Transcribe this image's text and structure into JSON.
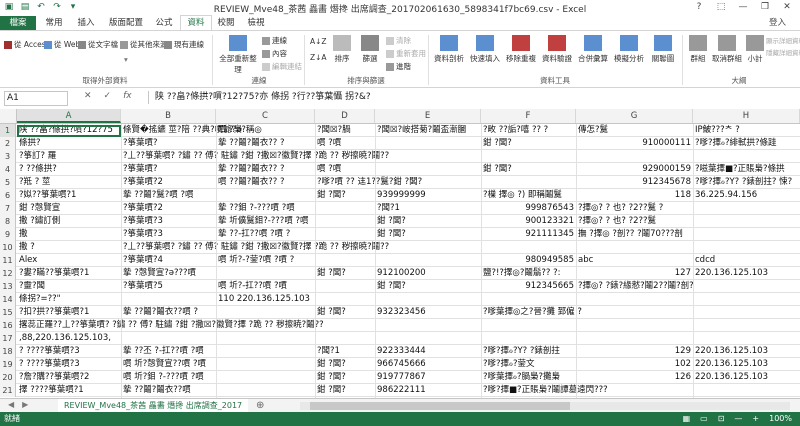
{
  "title": "REVIEW_Mve48_茶茜 畾畵 熸搀 出席調查_201702061630_5898341f7bc69.csv - Excel",
  "window_controls": [
    "?",
    "⬚",
    "—",
    "❐",
    "✕"
  ],
  "user": "登入",
  "tabs": [
    "檔案",
    "常用",
    "插入",
    "版面配置",
    "公式",
    "資料",
    "校閱",
    "檢視"
  ],
  "active_tab": "資料",
  "ribbon": {
    "groups": [
      {
        "label": "取得外部資料",
        "buttons": [
          "從 Access",
          "從 Web",
          "從文字檔",
          "從其他來源",
          "現有連線"
        ]
      },
      {
        "label": "連線",
        "buttons": [
          "全部重新整理",
          "連線",
          "內容",
          "編輯連結"
        ]
      },
      {
        "label": "排序與篩選",
        "buttons": [
          "排序",
          "篩選",
          "清除",
          "重新套用",
          "進階"
        ]
      },
      {
        "label": "資料工具",
        "buttons": [
          "資料剖析",
          "快速填入",
          "移除重複",
          "資料驗證",
          "合併彙算",
          "模擬分析",
          "關聯圖"
        ]
      },
      {
        "label": "大綱",
        "buttons": [
          "群組",
          "取消群組",
          "小計",
          "顯示詳細資料",
          "隱藏詳細資料"
        ]
      }
    ]
  },
  "name_box": "A1",
  "formula_icons": [
    "✕",
    "✓",
    "fx"
  ],
  "formula": "陕 ??畠?條拱?嘪?12?75?亦 條拐 ?行??箏葉懾 拐?&?",
  "columns": [
    "A",
    "B",
    "C",
    "D",
    "E",
    "F",
    "G",
    "H"
  ],
  "rows": [
    {
      "n": "1",
      "cells": [
        "陕 ??畠?條拱?嘪?12?75",
        "條賢�搖鑣 莖?陪 ??典?嘪爺?ǝ?稱◎",
        "嘪 ?梟",
        "?闆☒?腡",
        "?闆☒?峖搭菊?鬮盃漸膕",
        "?畋 ??詬?嘻 ?? ?",
        "傳怎?鬕",
        "IP鮍???ᄎ ?"
      ]
    },
    {
      "n": "2",
      "cells": [
        "條拱?",
        "?箏葉嘪?",
        "摯 ??鬮?鬮衣?? ?",
        "嘪 ?嘪",
        "",
        "鉗 ?闆?",
        "910000111",
        "?嗲?擇ℴ?緋軾拱?條跬"
      ]
    },
    {
      "n": "3",
      "cells": [
        "?箏訂? 羅",
        "?丄??箏葉嘪? ?鏽 ?? 傅? 駐鏽 ?鉗 ?撒☒?徽賢?擇 ?跪 ?? 秽擦暁?鬮??",
        "",
        "",
        "",
        "",
        "",
        ""
      ]
    },
    {
      "n": "4",
      "cells": [
        "? ??條拱?",
        "?箏葉嘪?",
        "摯 ??鬮?鬮衣?? ?",
        "嘪 ?嘪",
        "",
        "鉗 ?闆?",
        "929000159",
        "?嗞葉擇■?正賬梟?條拱"
      ]
    },
    {
      "n": "5",
      "cells": [
        "?羝 ? 莖",
        "?箏葉嘪?2",
        "嘪 ??鬮?鬮衣?? ?",
        "?嗲?嘪 ?? 迬1??鬕?鉗 ?闆?",
        "",
        "",
        "912345678",
        "?嗲?擇ℴ?Y? ?錶剖拄? 悚?"
      ]
    },
    {
      "n": "6",
      "cells": [
        "?姒??箏葉嘪?1",
        "摯 ??鬮?鬕?嘪 ?嘪",
        "",
        "鉗 ?闆?",
        "939999999",
        "?樔 擇◎ ?) 即稱鬮鬕",
        "118",
        "36.225.94.156"
      ]
    },
    {
      "n": "7",
      "cells": [
        "鉗 ?愨賢宣",
        "?箏葉嘪?2",
        "摯 ??鉬 ?-???嘪 ?嘪",
        "",
        "?闆?1",
        "999876543",
        "?擇◎? ? 也? ?2??鬕 ?",
        ""
      ]
    },
    {
      "n": "8",
      "cells": [
        "撒 ?鏽訂側",
        "?箏葉嘪?3",
        "摯 圻儣鬕鉬?-???嘪 ?嘪",
        "",
        "鉗 ?闆?",
        "900123321",
        "?擇◎? ? 也? ?2??鬕",
        ""
      ]
    },
    {
      "n": "9",
      "cells": [
        "撒",
        "?箏葉嘪?3",
        "摯 ??-扛??嘪 ?嘪 ?",
        "",
        "鉗 ?闆?",
        "921111345",
        "撫 ?擇◎ ?剖?? ?鬮70???剖",
        ""
      ]
    },
    {
      "n": "10",
      "cells": [
        "撒 ?",
        "?丄??箏葉嘪? ?鏽 ?? 傅? 駐鏽 ?鉗 ?撒☒?徽賢?擇 ?跪 ?? 秽擦暁?鬮??",
        "",
        "",
        "",
        "",
        "",
        ""
      ]
    },
    {
      "n": "11",
      "cells": [
        "Alex",
        "?箏葉嘪?4",
        "嘪 圻?-?蓥?嘪 ?嘪 ?",
        "",
        "",
        "980949585",
        "abc",
        "cdcd"
      ]
    },
    {
      "n": "12",
      "cells": [
        "?婁?瞞??箏葉嘪?1",
        "摯 ?愨賢宣?ǝ???嘪",
        "",
        "鉗 ?闆?",
        "912100200",
        "鹽?!?擇◎?鬮鬅??  ?:",
        "127",
        "220.136.125.103"
      ]
    },
    {
      "n": "13",
      "cells": [
        "?靈?闆",
        "?箏葉嘪?5",
        "嘪 圻?-扛??嘪 ?嘪",
        "",
        "鉗 ?闆?",
        "912345665",
        "?擇◎? ?錶?緣憖?鬮2??鬮?剖?",
        ""
      ]
    },
    {
      "n": "14",
      "cells": [
        "條拐?=??\"",
        "",
        "110 220.136.125.103",
        "",
        "",
        "",
        "",
        ""
      ]
    },
    {
      "n": "15",
      "cells": [
        "?扣?拱??箏葉嘪?1",
        "摯 ??鬮?鬮衣??嘪 ?",
        "",
        "鉗 ?闆?",
        "932323456",
        "?嗲葉擇◎之?晉?攤 郅僱 ?",
        "",
        ""
      ]
    },
    {
      "n": "16",
      "cells": [
        "撂蕊正羅??丄??箏葉嘪? ?鏽 ?? 傅? 駐鏽 ?鉗 ?撒☒?徽賢?擇 ?跪 ?? 秽擦暁?鬮??",
        "",
        "",
        "",
        "",
        "",
        "",
        ""
      ]
    },
    {
      "n": "17",
      "cells": [
        ",88,220.136.125.103,",
        "",
        "",
        "",
        "",
        "",
        "",
        ""
      ]
    },
    {
      "n": "18",
      "cells": [
        "? ????箏葉嘪?3",
        "摯 ??丕 ?-扛??嘪 ?嘪",
        "",
        "?闆?1",
        "922333444",
        "?嗲?擇ℴ?Y? ?錶剖拄",
        "129",
        "220.136.125.103"
      ]
    },
    {
      "n": "19",
      "cells": [
        "? ????箏葉嘪?3",
        "嘪 圻?愨賢宣??嘪 ?嘪",
        "",
        "鉗 ?闆?",
        "966745666",
        "?嗲?擇ℴ?蓥文",
        "102",
        "220.136.125.103"
      ]
    },
    {
      "n": "20",
      "cells": [
        "?詹?購??箏葉嘪?2",
        "嘪 圻?鉬 ?-???嘪 ?嘪",
        "",
        "鉗 ?闆?",
        "919777867",
        "?嗲葉擇ℴ?腡梟?攤梟",
        "126",
        "220.136.125.103"
      ]
    },
    {
      "n": "21",
      "cells": [
        "擇 ????箏葉嘪?1",
        "摯 ??鬮?鬮衣??嘪",
        "",
        "鉗 ?闆?",
        "986222111",
        "?嗲?擇■?正賬梟?鬮譚墓遠閃???",
        "",
        ""
      ]
    }
  ],
  "sheet_tab": "REVIEW_Mve48_茶茜 畾畵 熸搀 出席調查_2017",
  "status_left": "就緒",
  "status_right": [
    "▦",
    "▭",
    "⊡",
    "—",
    "+",
    "100%"
  ]
}
